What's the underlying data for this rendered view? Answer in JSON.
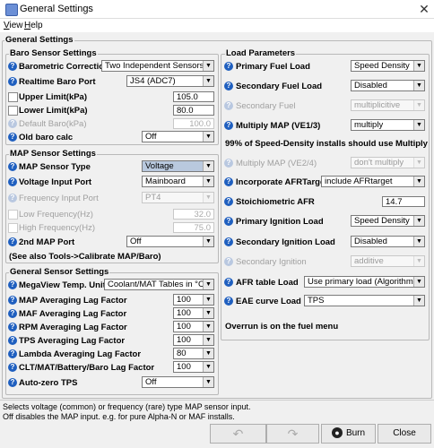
{
  "window": {
    "title": "General Settings"
  },
  "menu": [
    {
      "label": "View",
      "mnemonic": "V",
      "rest": "iew"
    },
    {
      "label": "Help",
      "mnemonic": "H",
      "rest": "elp"
    }
  ],
  "main_title": "General Settings",
  "baro": {
    "title": "Baro Sensor Settings",
    "barometric_correction": {
      "label": "Barometric Correction",
      "value": "Two Independent Sensors"
    },
    "realtime_baro_port": {
      "label": "Realtime Baro Port",
      "value": "JS4 (ADC7)"
    },
    "upper_limit": {
      "label": "Upper Limit(kPa)",
      "value": "105.0"
    },
    "lower_limit": {
      "label": "Lower Limit(kPa)",
      "value": "80.0"
    },
    "default_baro": {
      "label": "Default Baro(kPa)",
      "value": "100.0"
    },
    "old_baro_calc": {
      "label": "Old baro calc",
      "value": "Off"
    }
  },
  "map": {
    "title": "MAP Sensor Settings",
    "sensor_type": {
      "label": "MAP Sensor Type",
      "value": "Voltage"
    },
    "voltage_input_port": {
      "label": "Voltage Input Port",
      "value": "Mainboard"
    },
    "frequency_input_port": {
      "label": "Frequency Input Port",
      "value": "PT4"
    },
    "low_frequency": {
      "label": "Low Frequency(Hz)",
      "value": "32.0"
    },
    "high_frequency": {
      "label": "High Frequency(Hz)",
      "value": "75.0"
    },
    "second_map_port": {
      "label": "2nd MAP Port",
      "value": "Off"
    },
    "note": "(See also Tools->Calibrate MAP/Baro)"
  },
  "general": {
    "title": "General Sensor Settings",
    "megaview_units": {
      "label": "MegaView Temp. Units",
      "value": "Coolant/MAT Tables in °C"
    },
    "map_lag": {
      "label": "MAP Averaging Lag Factor",
      "value": "100"
    },
    "maf_lag": {
      "label": "MAF Averaging Lag Factor",
      "value": "100"
    },
    "rpm_lag": {
      "label": "RPM Averaging Lag Factor",
      "value": "100"
    },
    "tps_lag": {
      "label": "TPS Averaging Lag Factor",
      "value": "100"
    },
    "lambda_lag": {
      "label": "Lambda Averaging Lag Factor",
      "value": "80"
    },
    "clt_lag": {
      "label": "CLT/MAT/Battery/Baro Lag Factor",
      "value": "100"
    },
    "auto_zero_tps": {
      "label": "Auto-zero TPS",
      "value": "Off"
    }
  },
  "load": {
    "title": "Load Parameters",
    "primary_fuel_load": {
      "label": "Primary Fuel Load",
      "value": "Speed Density"
    },
    "secondary_fuel_load": {
      "label": "Secondary Fuel Load",
      "value": "Disabled"
    },
    "secondary_fuel": {
      "label": "Secondary Fuel",
      "value": "multiplicitive"
    },
    "multiply_map_ve13": {
      "label": "Multiply MAP (VE1/3)",
      "value": "multiply"
    },
    "note1": "99% of Speed-Density installs should use Multiply",
    "multiply_map_ve24": {
      "label": "Multiply MAP (VE2/4)",
      "value": "don't multiply"
    },
    "incorporate_afr": {
      "label": "Incorporate AFRTarget",
      "value": "include AFRtarget"
    },
    "stoich_afr": {
      "label": "Stoichiometric AFR",
      "value": "14.7"
    },
    "primary_ign_load": {
      "label": "Primary Ignition Load",
      "value": "Speed Density"
    },
    "secondary_ign_load": {
      "label": "Secondary Ignition Load",
      "value": "Disabled"
    },
    "secondary_ignition": {
      "label": "Secondary Ignition",
      "value": "additive"
    },
    "afr_table_load": {
      "label": "AFR table Load",
      "value": "Use primary load (Algorithm)"
    },
    "eae_curve_load": {
      "label": "EAE curve Load",
      "value": "TPS"
    },
    "note2": "Overrun is on the fuel menu"
  },
  "status": {
    "line1": "Selects voltage (common) or frequency (rare) type MAP sensor input.",
    "line2": "Off disables the MAP input. e.g. for pure Alpha-N or MAF installs."
  },
  "buttons": {
    "burn": "Burn",
    "close": "Close"
  }
}
